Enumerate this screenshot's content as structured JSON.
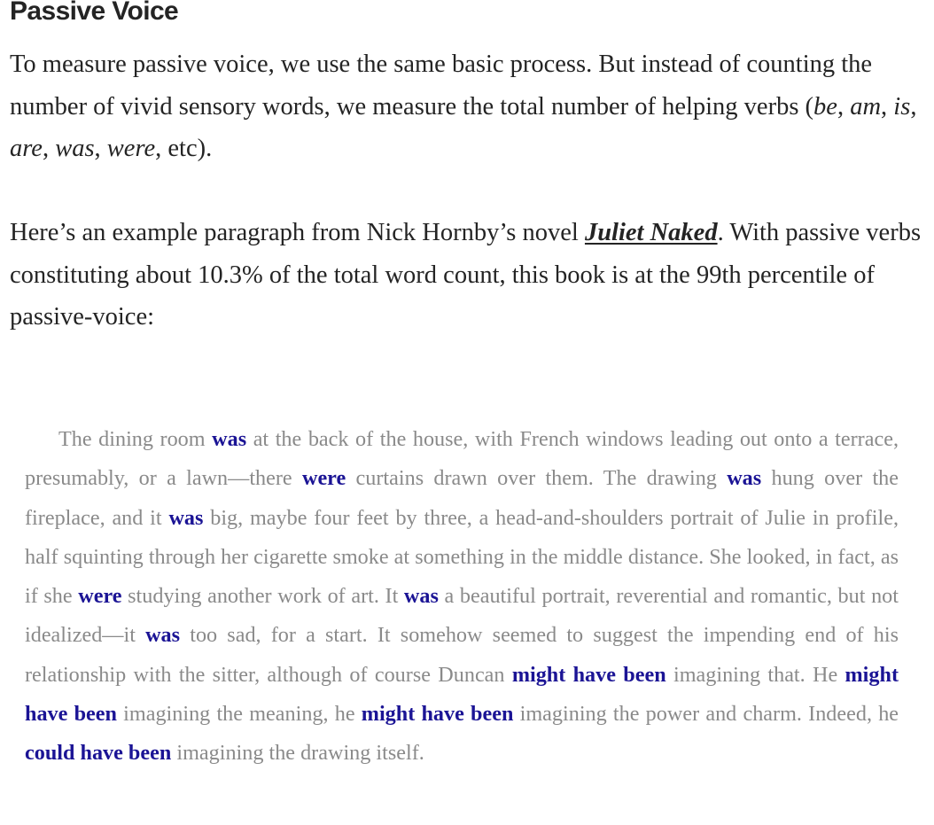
{
  "heading": "Passive Voice",
  "paragraph1": {
    "intro": "To measure passive voice, we use the same basic process. But instead of counting the number of vivid sensory words, we measure the total number of helping verbs (",
    "examples": [
      "be",
      "am",
      "is",
      "are",
      "was",
      "were"
    ],
    "separator": ", ",
    "outro": ", etc)."
  },
  "paragraph2": {
    "before_link": "Here’s an example paragraph from Nick Hornby’s novel ",
    "link_text": "Juliet Naked",
    "after_link": ". With passive verbs constituting about 10.3% of the total word count, this book is at the 99th percentile of passive-voice:"
  },
  "excerpt": {
    "highlight_color": "#1b1495",
    "text_color": "#8a8a8a",
    "segments": [
      {
        "t": "The dining room ",
        "hl": false
      },
      {
        "t": "was",
        "hl": true
      },
      {
        "t": " at the back of the house, with French windows leading out onto a terrace, presumably, or a lawn—there ",
        "hl": false
      },
      {
        "t": "were",
        "hl": true
      },
      {
        "t": " curtains drawn over them. The drawing ",
        "hl": false
      },
      {
        "t": "was",
        "hl": true
      },
      {
        "t": " hung over the fireplace, and it ",
        "hl": false
      },
      {
        "t": "was",
        "hl": true
      },
      {
        "t": " big, maybe four feet by three, a head-and-shoulders portrait of Julie in profile, half squinting through her cigarette smoke at something in the middle distance. She looked, in fact, as if she ",
        "hl": false
      },
      {
        "t": "were",
        "hl": true
      },
      {
        "t": " studying another work of art. It ",
        "hl": false
      },
      {
        "t": "was",
        "hl": true
      },
      {
        "t": " a beautiful portrait, reverential and romantic, but not idealized—it ",
        "hl": false
      },
      {
        "t": "was",
        "hl": true
      },
      {
        "t": " too sad, for a start. It somehow seemed to suggest the impending end of his relationship with the sitter, although of course Duncan ",
        "hl": false
      },
      {
        "t": "might have been",
        "hl": true
      },
      {
        "t": " imagining that. He ",
        "hl": false
      },
      {
        "t": "might have been",
        "hl": true
      },
      {
        "t": " imagining the meaning, he ",
        "hl": false
      },
      {
        "t": "might have been",
        "hl": true
      },
      {
        "t": " imagining the power and charm. Indeed, he ",
        "hl": false
      },
      {
        "t": "could have been",
        "hl": true
      },
      {
        "t": " imagining the drawing itself.",
        "hl": false
      }
    ]
  }
}
